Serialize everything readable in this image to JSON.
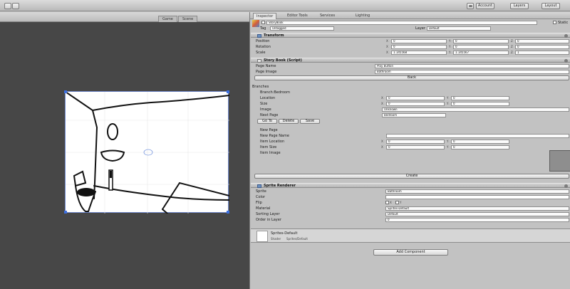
{
  "toolbar": {
    "layers_label": "Layers",
    "layout_label": "Layout",
    "account_label": "Account"
  },
  "scene": {
    "tabs": [
      "Game",
      "Scene"
    ]
  },
  "inspector": {
    "tabs": [
      "Inspector",
      "Editor Tools",
      "Services",
      "Lighting"
    ],
    "object": {
      "name": "StoryBook",
      "static_label": "Static",
      "tag_label": "Tag",
      "tag_value": "Untagged",
      "layer_label": "Layer",
      "layer_value": "Default"
    },
    "transform": {
      "title": "Transform",
      "rows": [
        {
          "label": "Position",
          "x": "0",
          "y": "0",
          "z": "0"
        },
        {
          "label": "Rotation",
          "x": "0",
          "y": "0",
          "z": "0"
        },
        {
          "label": "Scale",
          "x": "1.145568",
          "y": "1.145567",
          "z": "1"
        }
      ]
    },
    "storybook": {
      "title": "Story Book (Script)",
      "page_name_label": "Page Name",
      "page_name_value": "Play Button",
      "page_image_label": "Page Image",
      "page_image_value": "Bathroom",
      "back_label": "Back"
    },
    "branches": {
      "title": "Branches",
      "branch_name": "Branch:Bedroom",
      "location_label": "Location",
      "location_x": "0",
      "location_y": "0",
      "size_label": "Size",
      "size_x": "0",
      "size_y": "0",
      "image_label": "Image",
      "image_value": "Unknown",
      "next_page_label": "Next Page",
      "next_page_value": "Bedroom",
      "go_to_label": "Go To",
      "delete_label": "Delete",
      "save_label": "Save",
      "new_page_label": "New Page",
      "new_page_name_label": "New Page Name",
      "item_location_label": "Item Location",
      "item_location_x": "0",
      "item_location_y": "0",
      "item_size_label": "Item Size",
      "item_size_x": "0",
      "item_size_y": "0",
      "item_image_label": "Item Image",
      "create_label": "Create"
    },
    "sprite_renderer": {
      "title": "Sprite Renderer",
      "sprite_label": "Sprite",
      "sprite_value": "Bathroom",
      "color_label": "Color",
      "flip_label": "Flip",
      "material_label": "Material",
      "material_value": "Sprites-Default",
      "sorting_layer_label": "Sorting Layer",
      "sorting_layer_value": "Default",
      "order_label": "Order in Layer",
      "order_value": "0"
    },
    "material_preview": {
      "name": "Sprites-Default",
      "shader_label": "Shader",
      "shader_value": "Sprites/Default"
    },
    "add_component_label": "Add Component"
  }
}
